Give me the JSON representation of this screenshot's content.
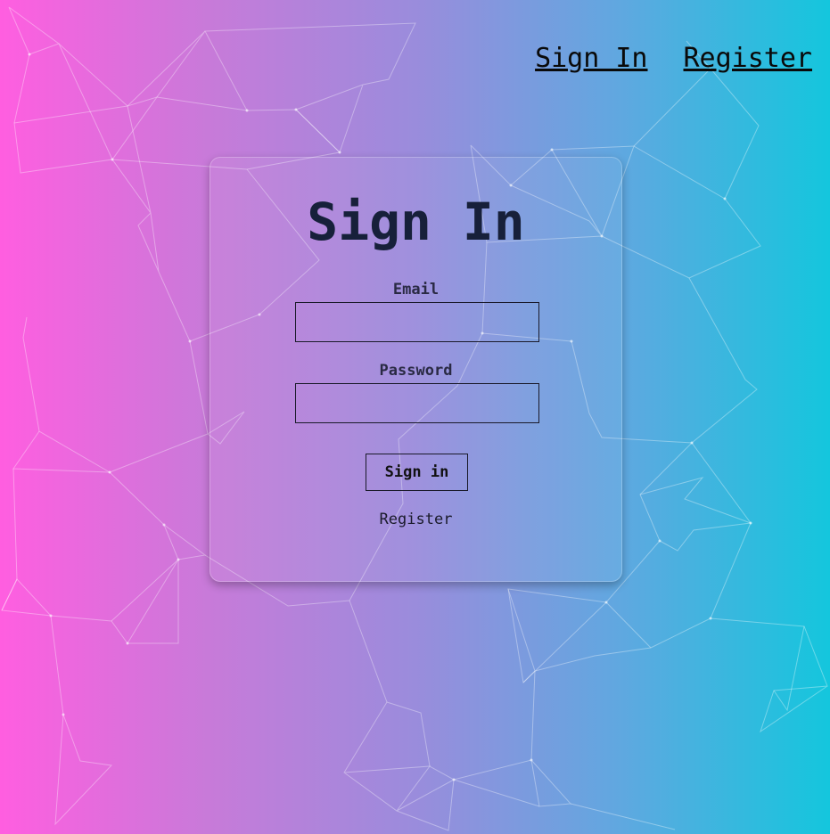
{
  "nav": {
    "sign_in": "Sign In",
    "register": "Register"
  },
  "form": {
    "title": "Sign In",
    "email_label": "Email",
    "email_value": "",
    "password_label": "Password",
    "password_value": "",
    "submit_label": "Sign in",
    "register_link": "Register"
  },
  "colors": {
    "gradient_left": "#ff5ee0",
    "gradient_right": "#14c6dd",
    "title": "#17203a"
  }
}
